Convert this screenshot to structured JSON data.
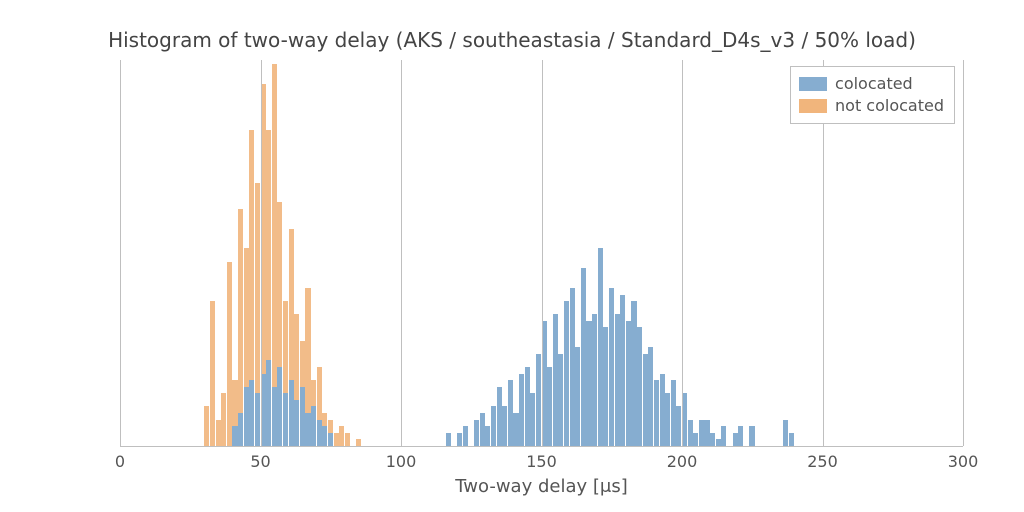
{
  "chart_data": {
    "type": "bar",
    "title": "Histogram of two-way delay (AKS / southeastasia / Standard_D4s_v3 / 50% load)",
    "xlabel": "Two-way delay [μs]",
    "ylabel": "",
    "xlim": [
      0,
      300
    ],
    "x_ticks": [
      0,
      50,
      100,
      150,
      200,
      250,
      300
    ],
    "bin_width": 2,
    "series": [
      {
        "name": "colocated",
        "color": "#86add0",
        "bins": [
          {
            "x": 116,
            "count": 2
          },
          {
            "x": 118,
            "count": 0
          },
          {
            "x": 120,
            "count": 2
          },
          {
            "x": 122,
            "count": 3
          },
          {
            "x": 124,
            "count": 0
          },
          {
            "x": 126,
            "count": 4
          },
          {
            "x": 128,
            "count": 5
          },
          {
            "x": 130,
            "count": 3
          },
          {
            "x": 132,
            "count": 6
          },
          {
            "x": 134,
            "count": 9
          },
          {
            "x": 136,
            "count": 6
          },
          {
            "x": 138,
            "count": 10
          },
          {
            "x": 140,
            "count": 5
          },
          {
            "x": 142,
            "count": 11
          },
          {
            "x": 144,
            "count": 12
          },
          {
            "x": 146,
            "count": 8
          },
          {
            "x": 148,
            "count": 14
          },
          {
            "x": 150,
            "count": 19
          },
          {
            "x": 152,
            "count": 12
          },
          {
            "x": 154,
            "count": 20
          },
          {
            "x": 156,
            "count": 14
          },
          {
            "x": 158,
            "count": 22
          },
          {
            "x": 160,
            "count": 24
          },
          {
            "x": 162,
            "count": 15
          },
          {
            "x": 164,
            "count": 27
          },
          {
            "x": 166,
            "count": 19
          },
          {
            "x": 168,
            "count": 20
          },
          {
            "x": 170,
            "count": 30
          },
          {
            "x": 172,
            "count": 18
          },
          {
            "x": 174,
            "count": 24
          },
          {
            "x": 176,
            "count": 20
          },
          {
            "x": 178,
            "count": 23
          },
          {
            "x": 180,
            "count": 19
          },
          {
            "x": 182,
            "count": 22
          },
          {
            "x": 184,
            "count": 18
          },
          {
            "x": 186,
            "count": 14
          },
          {
            "x": 188,
            "count": 15
          },
          {
            "x": 190,
            "count": 10
          },
          {
            "x": 192,
            "count": 11
          },
          {
            "x": 194,
            "count": 8
          },
          {
            "x": 196,
            "count": 10
          },
          {
            "x": 198,
            "count": 6
          },
          {
            "x": 200,
            "count": 8
          },
          {
            "x": 202,
            "count": 4
          },
          {
            "x": 204,
            "count": 2
          },
          {
            "x": 206,
            "count": 4
          },
          {
            "x": 208,
            "count": 4
          },
          {
            "x": 210,
            "count": 2
          },
          {
            "x": 212,
            "count": 1
          },
          {
            "x": 214,
            "count": 3
          },
          {
            "x": 216,
            "count": 0
          },
          {
            "x": 218,
            "count": 2
          },
          {
            "x": 220,
            "count": 3
          },
          {
            "x": 222,
            "count": 0
          },
          {
            "x": 224,
            "count": 3
          },
          {
            "x": 226,
            "count": 0
          },
          {
            "x": 236,
            "count": 4
          },
          {
            "x": 238,
            "count": 2
          }
        ]
      },
      {
        "name": "not colocated",
        "color": "#f1b57c",
        "bins": [
          {
            "x": 30,
            "count": 6
          },
          {
            "x": 32,
            "count": 22
          },
          {
            "x": 34,
            "count": 4
          },
          {
            "x": 36,
            "count": 8
          },
          {
            "x": 38,
            "count": 28
          },
          {
            "x": 40,
            "count": 10
          },
          {
            "x": 42,
            "count": 36
          },
          {
            "x": 44,
            "count": 30
          },
          {
            "x": 46,
            "count": 48
          },
          {
            "x": 48,
            "count": 40
          },
          {
            "x": 50,
            "count": 55
          },
          {
            "x": 52,
            "count": 48
          },
          {
            "x": 54,
            "count": 58
          },
          {
            "x": 56,
            "count": 37
          },
          {
            "x": 58,
            "count": 22
          },
          {
            "x": 60,
            "count": 33
          },
          {
            "x": 62,
            "count": 20
          },
          {
            "x": 64,
            "count": 16
          },
          {
            "x": 66,
            "count": 24
          },
          {
            "x": 68,
            "count": 10
          },
          {
            "x": 70,
            "count": 12
          },
          {
            "x": 72,
            "count": 5
          },
          {
            "x": 74,
            "count": 4
          },
          {
            "x": 76,
            "count": 2
          },
          {
            "x": 78,
            "count": 3
          },
          {
            "x": 80,
            "count": 2
          },
          {
            "x": 82,
            "count": 0
          },
          {
            "x": 84,
            "count": 1
          }
        ]
      }
    ],
    "colocated_overlay_bins": [
      {
        "x": 40,
        "count": 3
      },
      {
        "x": 42,
        "count": 5
      },
      {
        "x": 44,
        "count": 9
      },
      {
        "x": 46,
        "count": 10
      },
      {
        "x": 48,
        "count": 8
      },
      {
        "x": 50,
        "count": 11
      },
      {
        "x": 52,
        "count": 13
      },
      {
        "x": 54,
        "count": 9
      },
      {
        "x": 56,
        "count": 12
      },
      {
        "x": 58,
        "count": 8
      },
      {
        "x": 60,
        "count": 10
      },
      {
        "x": 62,
        "count": 7
      },
      {
        "x": 64,
        "count": 9
      },
      {
        "x": 66,
        "count": 5
      },
      {
        "x": 68,
        "count": 6
      },
      {
        "x": 70,
        "count": 4
      },
      {
        "x": 72,
        "count": 3
      },
      {
        "x": 74,
        "count": 2
      }
    ],
    "legend": {
      "items": [
        {
          "label": "colocated"
        },
        {
          "label": "not colocated"
        }
      ]
    }
  }
}
